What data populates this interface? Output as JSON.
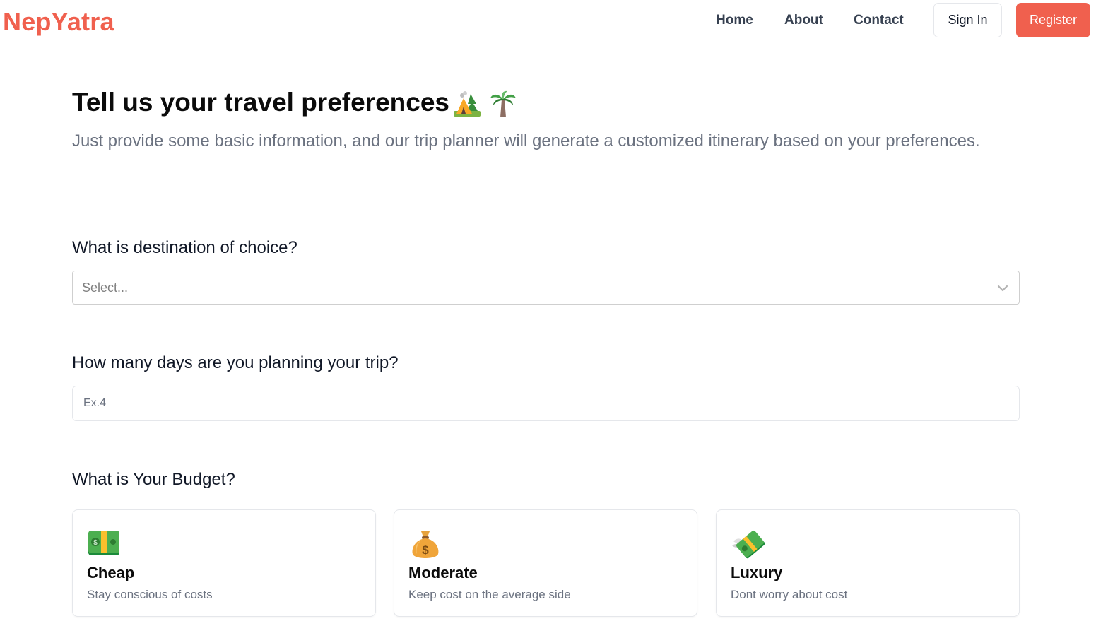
{
  "brand": {
    "name": "NepYatra",
    "color": "#f0604e"
  },
  "nav": {
    "links": [
      {
        "label": "Home"
      },
      {
        "label": "About"
      },
      {
        "label": "Contact"
      }
    ],
    "signin_label": "Sign In",
    "register_label": "Register"
  },
  "hero": {
    "title": "Tell us your travel preferences",
    "title_icons": [
      "camping-icon",
      "palm-tree-icon"
    ],
    "subtitle": "Just provide some basic information, and our trip planner will generate a customized itinerary based on your preferences."
  },
  "form": {
    "destination": {
      "label": "What is destination of choice?",
      "placeholder": "Select...",
      "icon": "chevron-down-icon"
    },
    "days": {
      "label": "How many days are you planning your trip?",
      "placeholder": "Ex.4",
      "value": ""
    },
    "budget": {
      "label": "What is Your Budget?",
      "options": [
        {
          "title": "Cheap",
          "desc": "Stay conscious of costs",
          "icon": "dollar-banknote-icon"
        },
        {
          "title": "Moderate",
          "desc": "Keep cost on the average side",
          "icon": "money-bag-icon"
        },
        {
          "title": "Luxury",
          "desc": "Dont worry about cost",
          "icon": "money-with-wings-icon"
        }
      ]
    }
  }
}
